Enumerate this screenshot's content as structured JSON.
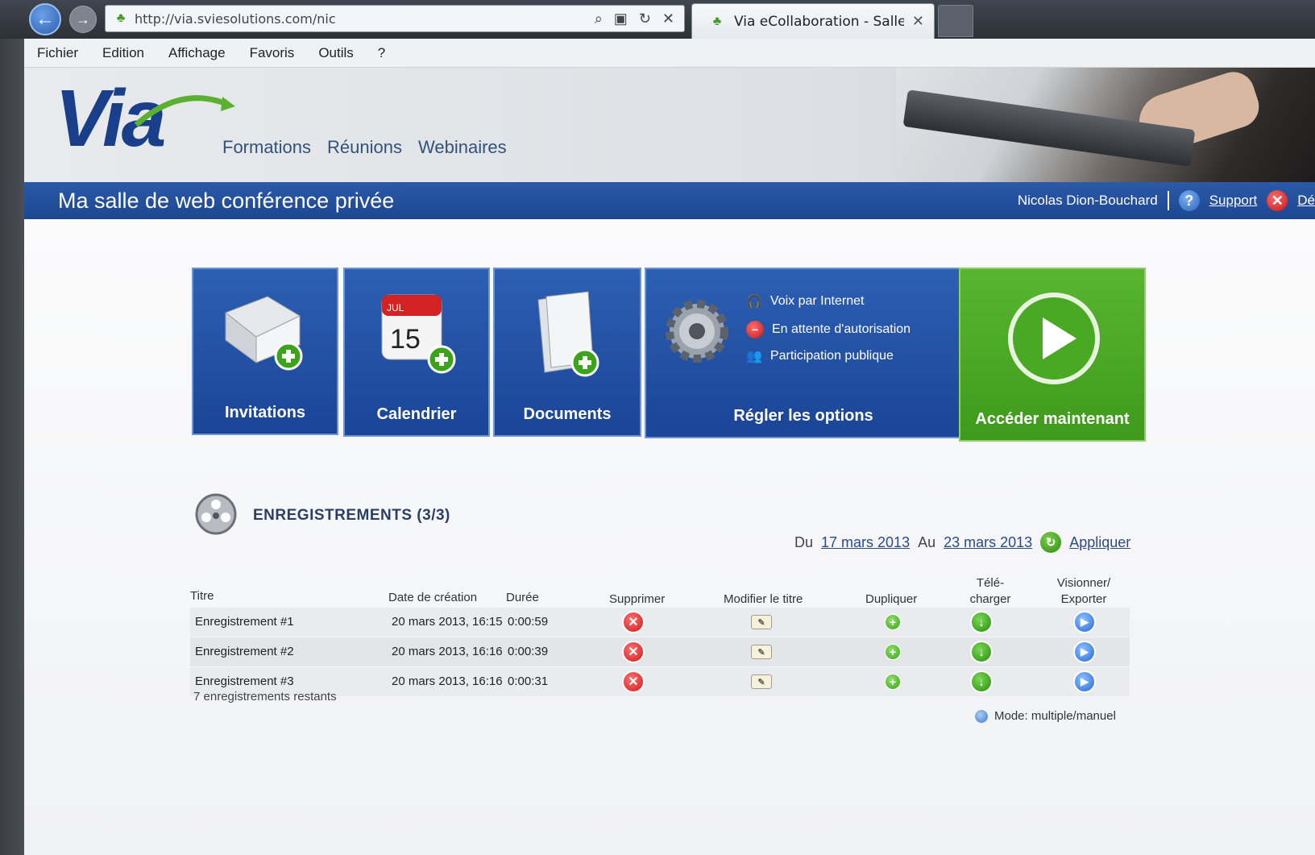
{
  "browser": {
    "url": "http://via.sviesolutions.com/nic",
    "tab_title": "Via eCollaboration - Salle pr...",
    "tab_close": "✕"
  },
  "menu": {
    "items": [
      "Fichier",
      "Edition",
      "Affichage",
      "Favoris",
      "Outils",
      "?"
    ]
  },
  "header": {
    "logo": "Via",
    "nav": [
      "Formations",
      "Réunions",
      "Webinaires"
    ]
  },
  "title_bar": {
    "title": "Ma salle de web conférence privée",
    "user": "Nicolas Dion-Bouchard",
    "support": "Support",
    "logout_partial": "Dé"
  },
  "tiles": {
    "invitations": "Invitations",
    "calendar": "Calendrier",
    "calendar_month": "JUL",
    "calendar_day": "15",
    "documents": "Documents",
    "options": "Régler les options",
    "options_list": [
      "Voix par Internet",
      "En attente d'autorisation",
      "Participation publique"
    ],
    "access": "Accéder maintenant"
  },
  "recordings": {
    "title": "ENREGISTREMENTS (3/3)",
    "filter": {
      "from_label": "Du",
      "from_date": "17 mars 2013",
      "to_label": "Au",
      "to_date": "23 mars 2013",
      "apply": "Appliquer"
    },
    "columns": {
      "title": "Titre",
      "created": "Date de création",
      "duration": "Durée",
      "delete": "Supprimer",
      "rename": "Modifier le titre",
      "duplicate": "Dupliquer",
      "download_1": "Télé-",
      "download_2": "charger",
      "view_1": "Visionner/",
      "view_2": "Exporter"
    },
    "rows": [
      {
        "title": "Enregistrement #1",
        "created": "20 mars 2013, 16:15",
        "duration": "0:00:59"
      },
      {
        "title": "Enregistrement #2",
        "created": "20 mars 2013, 16:16",
        "duration": "0:00:39"
      },
      {
        "title": "Enregistrement #3",
        "created": "20 mars 2013, 16:16",
        "duration": "0:00:31"
      }
    ],
    "remaining": "7 enregistrements restants",
    "mode": "Mode: multiple/manuel"
  }
}
